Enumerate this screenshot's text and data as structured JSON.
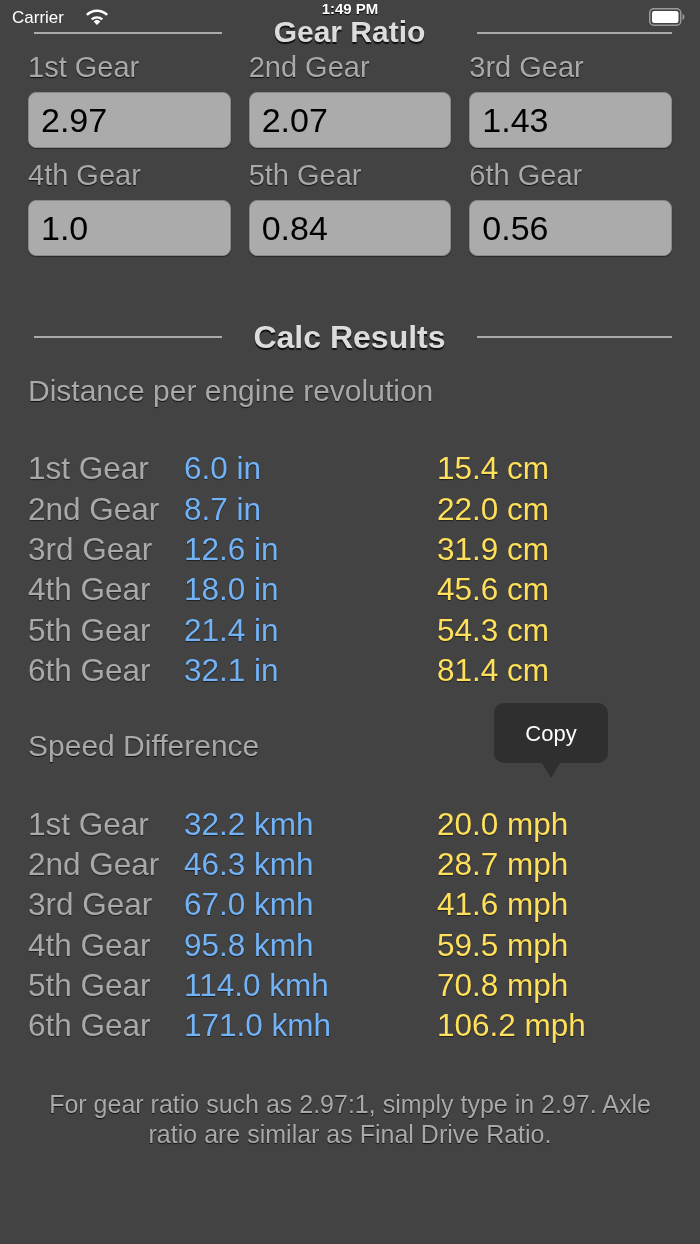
{
  "status_bar": {
    "carrier": "Carrier",
    "time": "1:49 PM"
  },
  "gear_ratio": {
    "title": "Gear Ratio",
    "fields": [
      {
        "label": "1st Gear",
        "value": "2.97"
      },
      {
        "label": "2nd Gear",
        "value": "2.07"
      },
      {
        "label": "3rd Gear",
        "value": "1.43"
      },
      {
        "label": "4th Gear",
        "value": "1.0"
      },
      {
        "label": "5th Gear",
        "value": "0.84"
      },
      {
        "label": "6th Gear",
        "value": "0.56"
      }
    ]
  },
  "calc_results": {
    "title": "Calc Results",
    "sections": [
      {
        "heading": "Distance per engine revolution",
        "rows": [
          {
            "label": "1st Gear",
            "values": [
              "6.0 in",
              "15.4 cm"
            ]
          },
          {
            "label": "2nd Gear",
            "values": [
              "8.7 in",
              "22.0 cm"
            ]
          },
          {
            "label": "3rd Gear",
            "values": [
              "12.6 in",
              "31.9 cm"
            ]
          },
          {
            "label": "4th Gear",
            "values": [
              "18.0 in",
              "45.6 cm"
            ]
          },
          {
            "label": "5th Gear",
            "values": [
              "21.4 in",
              "54.3 cm"
            ]
          },
          {
            "label": "6th Gear",
            "values": [
              "32.1 in",
              "81.4 cm"
            ]
          }
        ]
      },
      {
        "heading": "Speed Difference",
        "context_menu": {
          "label": "Copy"
        },
        "rows": [
          {
            "label": "1st Gear",
            "values": [
              "32.2 kmh",
              "20.0 mph"
            ]
          },
          {
            "label": "2nd Gear",
            "values": [
              "46.3 kmh",
              "28.7 mph"
            ]
          },
          {
            "label": "3rd Gear",
            "values": [
              "67.0 kmh",
              "41.6 mph"
            ]
          },
          {
            "label": "4th Gear",
            "values": [
              "95.8 kmh",
              "59.5 mph"
            ]
          },
          {
            "label": "5th Gear",
            "values": [
              "114.0 kmh",
              "70.8 mph"
            ]
          },
          {
            "label": "6th Gear",
            "values": [
              "171.0 kmh",
              "106.2 mph"
            ]
          }
        ]
      }
    ]
  },
  "footnote": "For gear ratio such as 2.97:1, simply type in 2.97. Axle ratio are similar as Final Drive Ratio."
}
